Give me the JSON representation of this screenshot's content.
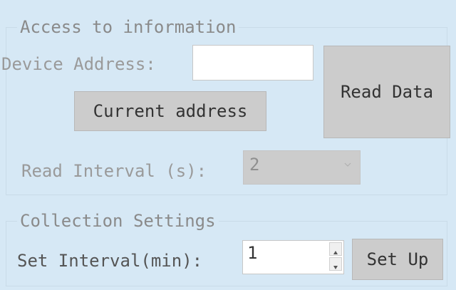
{
  "access_group": {
    "title": "Access to information",
    "device_address_label": "Device Address:",
    "device_address_value": "",
    "current_address_button": "Current address",
    "read_data_button": "Read Data",
    "read_interval_label": "Read Interval (s):",
    "read_interval_value": "2"
  },
  "collection_group": {
    "title": "Collection Settings",
    "set_interval_label": "Set Interval(min):",
    "set_interval_value": "1",
    "set_up_button": "Set Up"
  },
  "icons": {
    "combo_arrow": "chevron-down-icon",
    "spin_up": "triangle-up-icon",
    "spin_down": "triangle-down-icon"
  },
  "colors": {
    "panel_background": "#d6e8f5",
    "button_background": "#cccccc",
    "disabled_text": "#9a9a9a"
  }
}
